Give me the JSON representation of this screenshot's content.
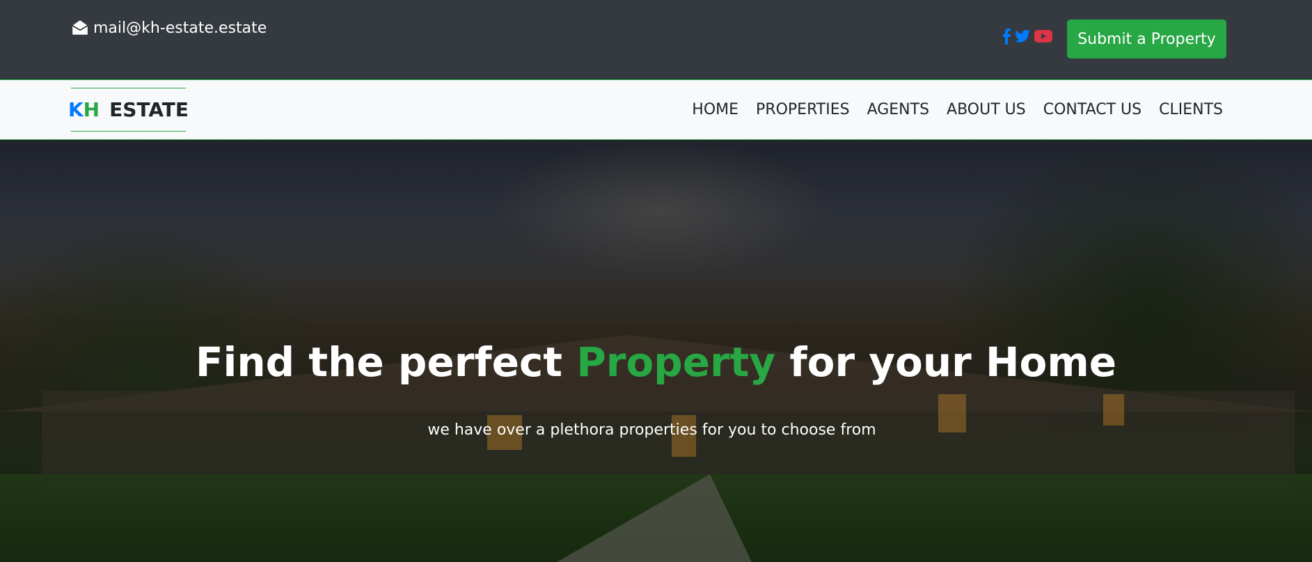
{
  "topbar": {
    "email": "mail@kh-estate.estate",
    "socials": [
      {
        "icon": "facebook-icon",
        "color": "#007bff"
      },
      {
        "icon": "twitter-icon",
        "color": "#007bff"
      },
      {
        "icon": "youtube-icon",
        "color": "#dc3545"
      }
    ],
    "submit_label": "Submit a Property"
  },
  "navbar": {
    "brand": {
      "k": "K",
      "h": "H",
      "estate": "ESTATE"
    },
    "links": [
      "HOME",
      "PROPERTIES",
      "AGENTS",
      "ABOUT US",
      "CONTACT US",
      "CLIENTS"
    ]
  },
  "hero": {
    "title_before": "Find the perfect ",
    "title_accent": "Property",
    "title_after": " for your Home",
    "subtitle": "we have over a plethora properties for you to choose from"
  },
  "colors": {
    "topbar_bg": "#343a40",
    "accent_green": "#28a745",
    "brand_blue": "#007bff",
    "youtube_red": "#dc3545"
  }
}
